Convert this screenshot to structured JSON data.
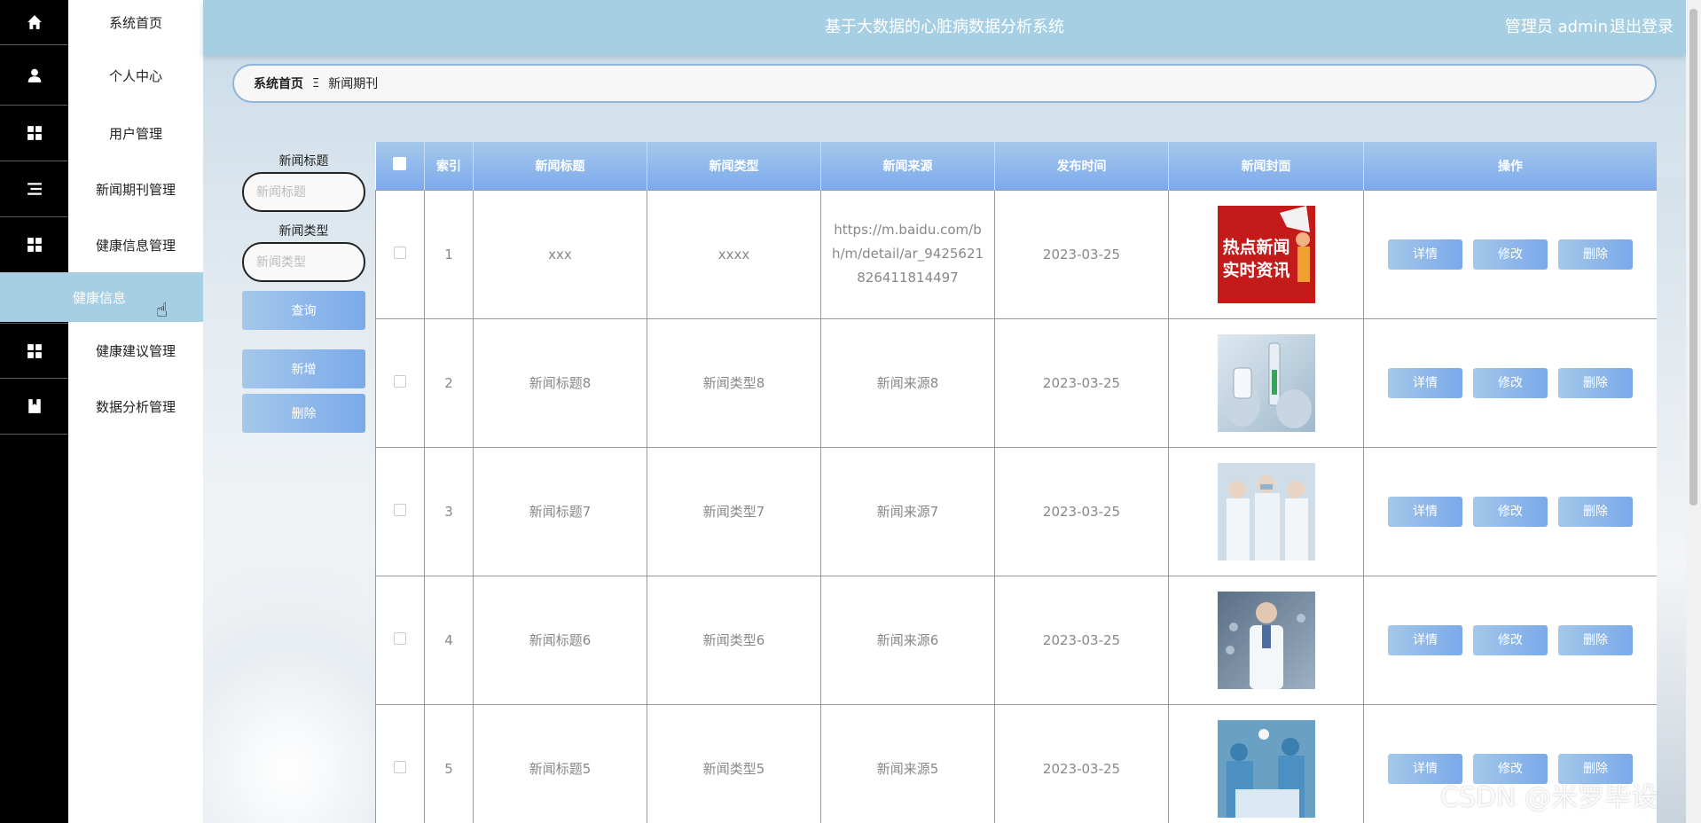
{
  "app": {
    "title": "基于大数据的心脏病数据分析系统",
    "user_label": "管理员 admin",
    "logout_label": "退出登录"
  },
  "menu": {
    "items": [
      {
        "label": "系统首页",
        "icon": "home-icon"
      },
      {
        "label": "个人中心",
        "icon": "user-icon"
      },
      {
        "label": "用户管理",
        "icon": "grid-icon"
      },
      {
        "label": "新闻期刊管理",
        "icon": "list-icon"
      },
      {
        "label": "健康信息管理",
        "icon": "grid-icon"
      },
      {
        "label": "健康建议管理",
        "icon": "grid-icon"
      },
      {
        "label": "数据分析管理",
        "icon": "book-icon"
      }
    ],
    "active_sub": "健康信息"
  },
  "breadcrumb": {
    "home": "系统首页",
    "separator": "Ξ",
    "current": "新闻期刊"
  },
  "search": {
    "title_label": "新闻标题",
    "title_placeholder": "新闻标题",
    "type_label": "新闻类型",
    "type_placeholder": "新闻类型",
    "query_button": "查询",
    "add_button": "新增",
    "delete_button": "删除"
  },
  "table": {
    "headers": [
      "索引",
      "新闻标题",
      "新闻类型",
      "新闻来源",
      "发布时间",
      "新闻封面",
      "操作"
    ],
    "actions": {
      "detail": "详情",
      "edit": "修改",
      "delete": "删除"
    },
    "rows": [
      {
        "index": "1",
        "title": "xxx",
        "type": "xxxx",
        "source": "https://m.baidu.com/bh/m/detail/ar_9425621826411814497",
        "date": "2023-03-25",
        "cover": "hot-news-cover",
        "cover_text_1": "热点新闻",
        "cover_text_2": "实时资讯"
      },
      {
        "index": "2",
        "title": "新闻标题8",
        "type": "新闻类型8",
        "source": "新闻来源8",
        "date": "2023-03-25",
        "cover": "vaccine-cover"
      },
      {
        "index": "3",
        "title": "新闻标题7",
        "type": "新闻类型7",
        "source": "新闻来源7",
        "date": "2023-03-25",
        "cover": "medical-team-cover"
      },
      {
        "index": "4",
        "title": "新闻标题6",
        "type": "新闻类型6",
        "source": "新闻来源6",
        "date": "2023-03-25",
        "cover": "doctor-cover"
      },
      {
        "index": "5",
        "title": "新闻标题5",
        "type": "新闻类型5",
        "source": "新闻来源5",
        "date": "2023-03-25",
        "cover": "surgery-cover"
      }
    ]
  },
  "watermark": "CSDN @米罗毕设",
  "colors": {
    "header": "#a7cfe3",
    "accent_start": "#a4c8ea",
    "accent_end": "#7aa9ea",
    "rail": "#000000"
  }
}
